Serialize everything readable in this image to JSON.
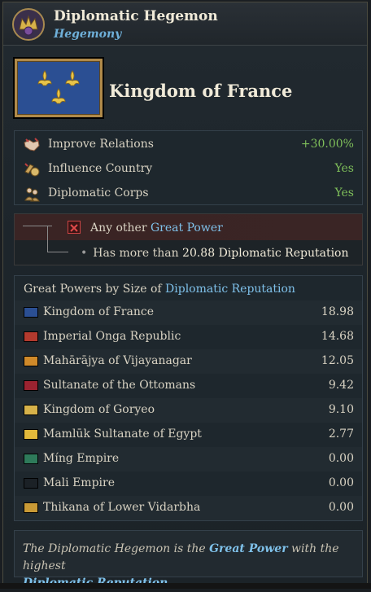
{
  "header": {
    "title": "Diplomatic Hegemon",
    "subtitle": "Hegemony",
    "icon": "hegemony-crown-icon"
  },
  "country": {
    "name": "Kingdom of France",
    "flag": "fleur-de-lis-flag"
  },
  "stats": [
    {
      "icon": "handshake-icon",
      "label": "Improve Relations",
      "value": "+30.00%"
    },
    {
      "icon": "scroll-influence-icon",
      "label": "Influence Country",
      "value": "Yes"
    },
    {
      "icon": "diplomat-icon",
      "label": "Diplomatic Corps",
      "value": "Yes"
    }
  ],
  "requirement": {
    "status": "failed",
    "text_prefix": "Any other ",
    "text_link": "Great Power",
    "sub_bullet": "•",
    "sub_prefix": "Has more than ",
    "sub_value": "20.88 Diplomatic Reputation"
  },
  "great_powers": {
    "header_prefix": "Great Powers by Size of ",
    "header_link": "Diplomatic Reputation",
    "rows": [
      {
        "name": "Kingdom of France",
        "value": "18.98",
        "color": "#2b4f93"
      },
      {
        "name": "Imperial Onga Republic",
        "value": "14.68",
        "color": "#b33a2e"
      },
      {
        "name": "Mahārājya of Vijayanagar",
        "value": "12.05",
        "color": "#d08a2a"
      },
      {
        "name": "Sultanate of the Ottomans",
        "value": "9.42",
        "color": "#9b2330"
      },
      {
        "name": "Kingdom of Goryeo",
        "value": "9.10",
        "color": "#d7b24a"
      },
      {
        "name": "Mamlūk Sultanate of Egypt",
        "value": "2.77",
        "color": "#e3b93b"
      },
      {
        "name": "Míng Empire",
        "value": "0.00",
        "color": "#2e7a5a"
      },
      {
        "name": "Mali Empire",
        "value": "0.00",
        "color": "#1b2126"
      },
      {
        "name": "Thikana of Lower Vidarbha",
        "value": "0.00",
        "color": "#c99a36"
      }
    ]
  },
  "footer": {
    "p1": "The Diplomatic Hegemon is the ",
    "link1": "Great Power",
    "p2": " with the highest ",
    "link2": "Diplomatic Reputation",
    "p3": "."
  }
}
